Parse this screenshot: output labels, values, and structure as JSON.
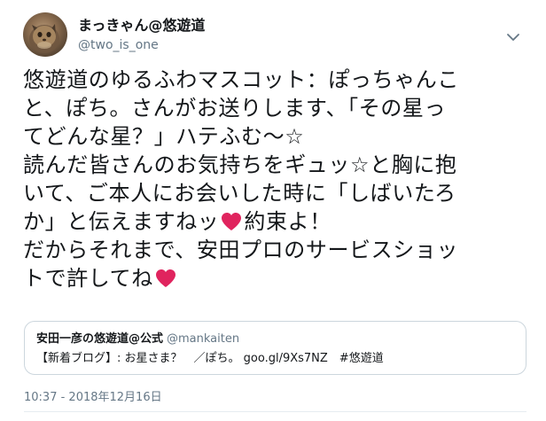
{
  "author": {
    "display_name": "まっきゃん@悠遊道",
    "username": "@two_is_one",
    "avatar_icon": "cat-photo-avatar"
  },
  "menu_icon": "chevron-down-icon",
  "tweet": {
    "lines": [
      {
        "text": "悠遊道のゆるふわマスコット：ぽっちゃんこ"
      },
      {
        "text": "と、ぽち。さんがお送りします、「その星っ"
      },
      {
        "text": "てどんな星？」ハテふむ〜☆"
      },
      {
        "text": "読んだ皆さんのお気持ちをギュッ☆と胸に抱"
      },
      {
        "text": "いて、ご本人にお会いした時に「しばいたろ"
      },
      {
        "text": "か」と伝えますねッ",
        "heart": true,
        "after": "約束よ！"
      },
      {
        "text": "だからそれまで、安田プロのサービスショッ"
      },
      {
        "text": "トで許してね",
        "heart": true,
        "after": ""
      }
    ],
    "heart_color": "#e0245e"
  },
  "quote": {
    "name": "安田一彦の悠遊道@公式",
    "handle": "@mankaiten",
    "body": "【新着ブログ】: お星さま？　／ぽち。 goo.gl/9Xs7NZ　#悠遊道"
  },
  "timestamp": "10:37 - 2018年12月16日",
  "colors": {
    "text": "#14171a",
    "secondary": "#657786",
    "border": "#ccd6dd"
  }
}
